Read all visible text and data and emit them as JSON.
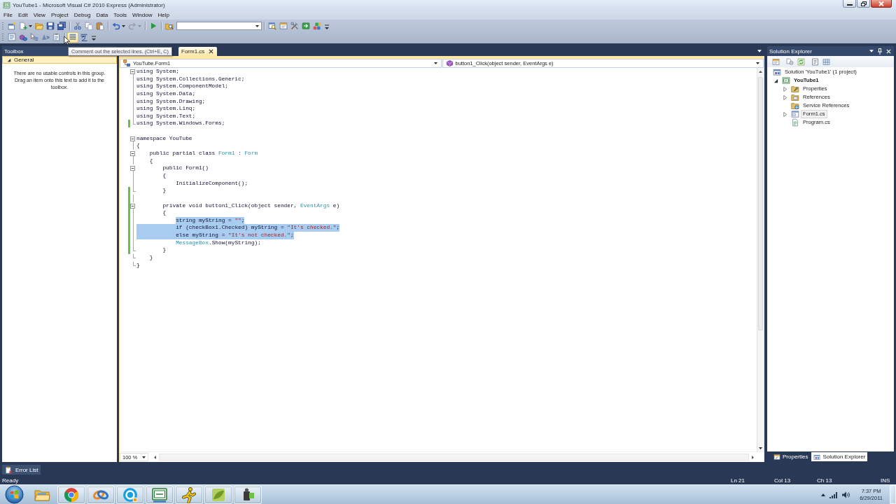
{
  "window": {
    "title": "YouTube1 - Microsoft Visual C# 2010 Express (Administrator)"
  },
  "menu": [
    "File",
    "Edit",
    "View",
    "Project",
    "Debug",
    "Data",
    "Tools",
    "Window",
    "Help"
  ],
  "toolbars": [
    {
      "groups": [
        {
          "items": [
            {
              "kind": "button",
              "hovered": false,
              "disabled": false,
              "dropdown": false
            },
            {
              "kind": "button",
              "hovered": false,
              "disabled": false,
              "dropdown": true
            },
            {
              "kind": "button",
              "hovered": false,
              "disabled": false,
              "dropdown": false
            },
            {
              "kind": "button",
              "hovered": false,
              "disabled": false,
              "dropdown": false
            },
            {
              "kind": "button",
              "hovered": false,
              "disabled": false,
              "dropdown": false
            }
          ]
        },
        {
          "items": [
            {
              "kind": "button",
              "hovered": false,
              "disabled": false,
              "dropdown": false
            },
            {
              "kind": "button",
              "hovered": false,
              "disabled": false,
              "dropdown": false
            },
            {
              "kind": "button",
              "hovered": false,
              "disabled": false,
              "dropdown": false
            }
          ]
        },
        {
          "items": [
            {
              "kind": "button",
              "hovered": false,
              "disabled": false,
              "dropdown": true
            },
            {
              "kind": "button",
              "hovered": false,
              "disabled": true,
              "dropdown": true
            }
          ]
        },
        {
          "items": [
            {
              "kind": "button",
              "hovered": false,
              "disabled": false,
              "dropdown": false
            }
          ]
        },
        {
          "items": [
            {
              "kind": "button",
              "hovered": false,
              "disabled": false,
              "dropdown": false
            },
            {
              "kind": "combo"
            }
          ]
        },
        {
          "items": [
            {
              "kind": "button",
              "hovered": false,
              "disabled": false,
              "dropdown": false
            },
            {
              "kind": "button",
              "hovered": false,
              "disabled": false,
              "dropdown": false
            },
            {
              "kind": "button",
              "hovered": false,
              "disabled": false,
              "dropdown": false
            },
            {
              "kind": "button",
              "hovered": false,
              "disabled": false,
              "dropdown": false
            },
            {
              "kind": "button",
              "hovered": false,
              "disabled": false,
              "dropdown": false
            }
          ]
        }
      ]
    },
    {
      "groups": [
        {
          "items": [
            {
              "kind": "button",
              "hovered": false,
              "disabled": false,
              "dropdown": false
            },
            {
              "kind": "button",
              "hovered": false,
              "disabled": false,
              "dropdown": false
            },
            {
              "kind": "button",
              "hovered": false,
              "disabled": false,
              "dropdown": false
            },
            {
              "kind": "button",
              "hovered": false,
              "disabled": false,
              "dropdown": false
            },
            {
              "kind": "button",
              "hovered": false,
              "disabled": false,
              "dropdown": false
            }
          ]
        },
        {
          "items": [
            {
              "kind": "button",
              "hovered": true,
              "disabled": false,
              "dropdown": false
            },
            {
              "kind": "button",
              "hovered": false,
              "disabled": false,
              "dropdown": false
            }
          ]
        }
      ]
    }
  ],
  "tooltip": {
    "text": "Comment out the selected lines. (Ctrl+E, C)"
  },
  "toolbox": {
    "title": "Toolbox",
    "group": {
      "label": "General",
      "expanded": true
    },
    "hint": "There are no usable controls in this group. Drag an item onto this text to add it to the toolbox."
  },
  "editor": {
    "tabs": [
      {
        "label": "Form1.cs",
        "selected": true
      }
    ],
    "type_dropdown": "YouTube.Form1",
    "member_dropdown": "button1_Click(object sender, EventArgs e)",
    "lines": [
      {
        "kind": "start",
        "segments": [
          {
            "text": "using System;",
            "kind": "plain"
          }
        ],
        "changed": false,
        "selected": false
      },
      {
        "kind": "inside",
        "segments": [
          {
            "text": "using System.Collections.Generic;",
            "kind": "plain"
          }
        ],
        "changed": false,
        "selected": false
      },
      {
        "kind": "inside",
        "segments": [
          {
            "text": "using System.ComponentModel;",
            "kind": "plain"
          }
        ],
        "changed": false,
        "selected": false
      },
      {
        "kind": "inside",
        "segments": [
          {
            "text": "using System.Data;",
            "kind": "plain"
          }
        ],
        "changed": false,
        "selected": false
      },
      {
        "kind": "inside",
        "segments": [
          {
            "text": "using System.Drawing;",
            "kind": "plain"
          }
        ],
        "changed": false,
        "selected": false
      },
      {
        "kind": "inside",
        "segments": [
          {
            "text": "using System.Linq;",
            "kind": "plain"
          }
        ],
        "changed": false,
        "selected": false
      },
      {
        "kind": "inside",
        "segments": [
          {
            "text": "using System.Text;",
            "kind": "plain"
          }
        ],
        "changed": false,
        "selected": false
      },
      {
        "kind": "end",
        "segments": [
          {
            "text": "using System.Windows.Forms;",
            "kind": "plain"
          }
        ],
        "changed": true,
        "selected": false
      },
      {
        "kind": "none",
        "changed": false,
        "selected": false
      },
      {
        "kind": "start",
        "segments": [
          {
            "text": "namespace YouTube",
            "kind": "plain"
          }
        ],
        "changed": false,
        "selected": false
      },
      {
        "kind": "inside",
        "segments": [
          {
            "text": "{",
            "kind": "plain"
          }
        ],
        "changed": false,
        "selected": false
      },
      {
        "kind": "start",
        "segments": [
          {
            "text": "    public partial class ",
            "kind": "plain"
          },
          {
            "text": "Form1",
            "kind": "type"
          },
          {
            "text": " : ",
            "kind": "plain"
          },
          {
            "text": "Form",
            "kind": "type"
          }
        ],
        "changed": false,
        "selected": false
      },
      {
        "kind": "inside",
        "segments": [
          {
            "text": "    {",
            "kind": "plain"
          }
        ],
        "changed": false,
        "selected": false
      },
      {
        "kind": "start",
        "segments": [
          {
            "text": "        public Form1()",
            "kind": "plain"
          }
        ],
        "changed": false,
        "selected": false
      },
      {
        "kind": "inside",
        "segments": [
          {
            "text": "        {",
            "kind": "plain"
          }
        ],
        "changed": false,
        "selected": false
      },
      {
        "kind": "inside",
        "segments": [
          {
            "text": "            InitializeComponent();",
            "kind": "plain"
          }
        ],
        "changed": false,
        "selected": false
      },
      {
        "kind": "end",
        "segments": [
          {
            "text": "        }",
            "kind": "plain"
          }
        ],
        "changed": true,
        "selected": false
      },
      {
        "kind": "inside",
        "changed": true,
        "selected": false
      },
      {
        "kind": "start",
        "segments": [
          {
            "text": "        private void button1_Click(object sender, ",
            "kind": "plain"
          },
          {
            "text": "EventArgs",
            "kind": "type"
          },
          {
            "text": " e)",
            "kind": "plain"
          }
        ],
        "changed": true,
        "selected": false
      },
      {
        "kind": "inside",
        "segments": [
          {
            "text": "        {",
            "kind": "plain"
          }
        ],
        "changed": true,
        "selected": false
      },
      {
        "kind": "inside",
        "segments": [
          {
            "text": "            string myString = ",
            "kind": "plain",
            "selected": true
          },
          {
            "text": "\"\"",
            "kind": "string",
            "selected": true
          },
          {
            "text": ";",
            "kind": "plain",
            "selected": true
          }
        ],
        "changed": true,
        "selected": false
      },
      {
        "kind": "inside",
        "segments": [
          {
            "text": "            if (checkBox1.Checked) myString = ",
            "kind": "plain"
          },
          {
            "text": "\"It's checked.\"",
            "kind": "string"
          },
          {
            "text": ";",
            "kind": "plain"
          }
        ],
        "changed": true,
        "selected": true
      },
      {
        "kind": "inside",
        "segments": [
          {
            "text": "            else myString = ",
            "kind": "plain"
          },
          {
            "text": "\"It's not checked.\"",
            "kind": "string"
          },
          {
            "text": ";",
            "kind": "plain"
          }
        ],
        "changed": true,
        "selected": true
      },
      {
        "kind": "inside",
        "segments": [
          {
            "text": "            MessageBox",
            "kind": "type"
          },
          {
            "text": ".Show(myString);",
            "kind": "plain"
          }
        ],
        "changed": true,
        "selected": false
      },
      {
        "kind": "end",
        "segments": [
          {
            "text": "        }",
            "kind": "plain"
          }
        ],
        "changed": true,
        "selected": false
      },
      {
        "kind": "end",
        "segments": [
          {
            "text": "    }",
            "kind": "plain"
          }
        ],
        "changed": false,
        "selected": false
      },
      {
        "kind": "end",
        "segments": [
          {
            "text": "}",
            "kind": "plain"
          }
        ],
        "changed": false,
        "selected": false
      }
    ],
    "zoom": "100 %"
  },
  "solution_explorer": {
    "title": "Solution Explorer",
    "tree": [
      {
        "label": "Solution 'YouTube1' (1 project)",
        "kind": "solution",
        "bold": false,
        "selected": false,
        "children": [
          {
            "label": "YouTube1",
            "kind": "project",
            "bold": true,
            "selected": false,
            "expanded": true,
            "children": [
              {
                "label": "Properties",
                "kind": "properties",
                "bold": false,
                "selected": false,
                "expanded": false
              },
              {
                "label": "References",
                "kind": "references",
                "bold": false,
                "selected": false,
                "expanded": false
              },
              {
                "label": "Service References",
                "kind": "service_references",
                "bold": false,
                "selected": false
              },
              {
                "label": "Form1.cs",
                "kind": "form",
                "bold": false,
                "selected": true,
                "expanded": false
              },
              {
                "label": "Program.cs",
                "kind": "source",
                "bold": false,
                "selected": false
              }
            ]
          }
        ]
      }
    ],
    "tabs": [
      {
        "label": "Properties",
        "selected": false
      },
      {
        "label": "Solution Explorer",
        "selected": true
      }
    ]
  },
  "output_tabs": [
    {
      "label": "Error List"
    }
  ],
  "status_bar": {
    "message": "Ready",
    "line": "Ln 21",
    "column": "Col 13",
    "character": "Ch 13",
    "mode": "INS"
  },
  "taskbar": {
    "apps": [
      {
        "running": false
      },
      {
        "running": true
      },
      {
        "running": true
      },
      {
        "running": true
      },
      {
        "running": true
      },
      {
        "running": true
      },
      {
        "running": true
      },
      {
        "running": true
      }
    ],
    "time": "7:37 PM",
    "date": "6/29/2011"
  }
}
